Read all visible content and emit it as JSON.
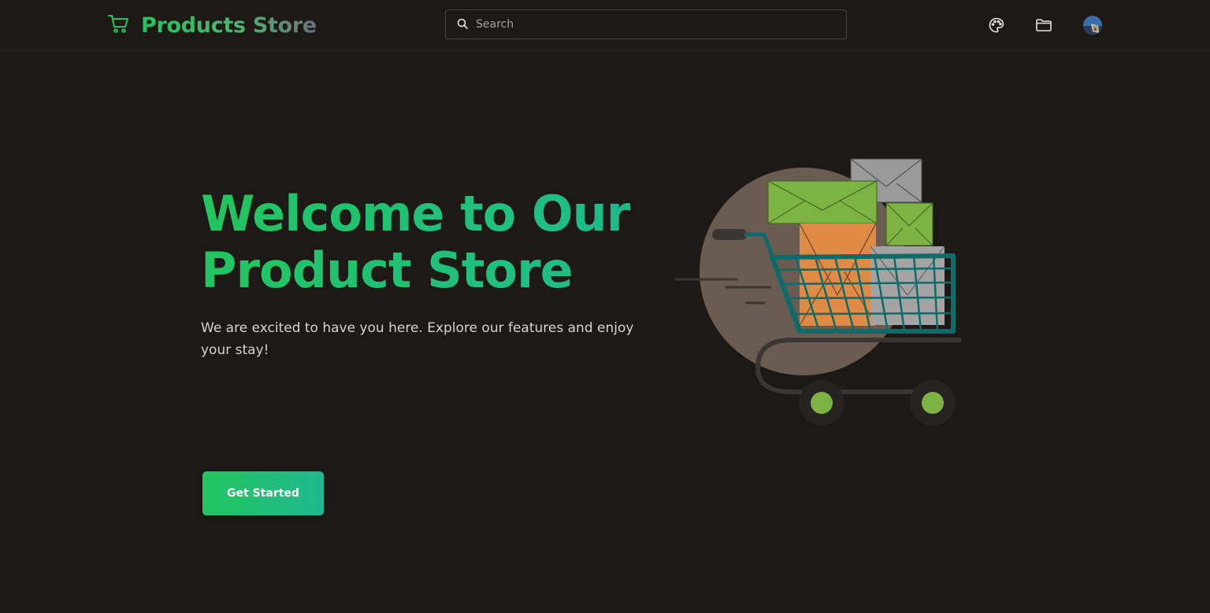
{
  "header": {
    "brand": {
      "title": "Products Store",
      "icon": "shopping-cart-icon",
      "colors": {
        "start": "#22c55e",
        "end": "#6b7280"
      }
    },
    "search": {
      "placeholder": "Search",
      "value": "",
      "icon": "search-icon"
    },
    "actions": [
      {
        "icon": "palette-icon"
      },
      {
        "icon": "folder-icon"
      },
      {
        "icon": "avatar"
      }
    ]
  },
  "hero": {
    "title": "Welcome to Our Product Store",
    "subtitle": "We are excited to have you here. Explore our features and enjoy your stay!",
    "cta_label": "Get Started",
    "illustration_icon": "shopping-cart-illustration"
  },
  "colors": {
    "background": "#1c1917",
    "accent": "#22c55e",
    "accent_secondary": "#1fb891",
    "text": "#d6d3d1"
  }
}
